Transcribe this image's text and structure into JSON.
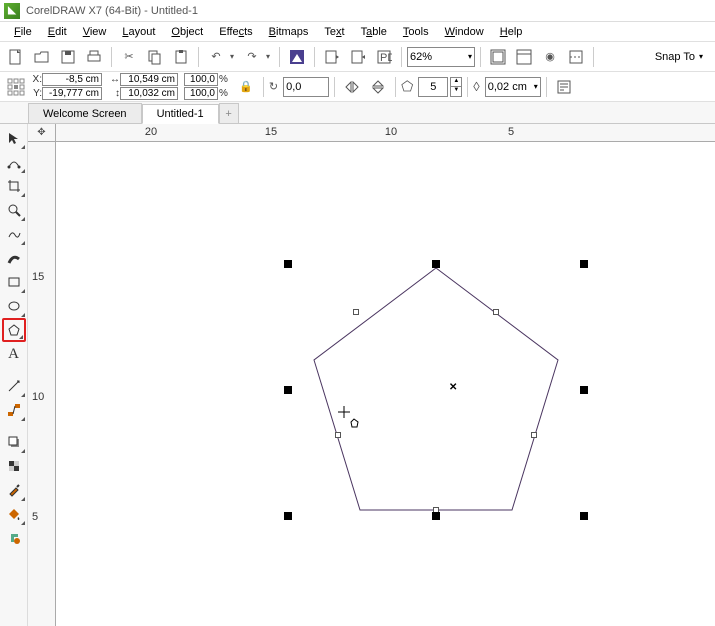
{
  "title": "CorelDRAW X7 (64-Bit) - Untitled-1",
  "menu": [
    "File",
    "Edit",
    "View",
    "Layout",
    "Object",
    "Effects",
    "Bitmaps",
    "Text",
    "Table",
    "Tools",
    "Window",
    "Help"
  ],
  "zoom": "62%",
  "snap": "Snap To",
  "props": {
    "x": "-8,5 cm",
    "y": "-19,777 cm",
    "w": "10,549 cm",
    "h": "10,032 cm",
    "sx": "100,0",
    "sy": "100,0",
    "rot": "0,0",
    "sides": "5",
    "outline": "0,02 cm"
  },
  "tabs": {
    "welcome": "Welcome Screen",
    "doc": "Untitled-1",
    "add": "+"
  },
  "ruler_h": {
    "a": "20",
    "b": "15",
    "c": "10",
    "d": "5"
  },
  "ruler_v": {
    "a": "15",
    "b": "10",
    "c": "5"
  },
  "chart_data": {
    "type": "polygon",
    "sides": 5,
    "position_cm": [
      -8.5,
      -19.777
    ],
    "size_cm": [
      10.549,
      10.032
    ],
    "scale_pct": [
      100.0,
      100.0
    ],
    "rotation_deg": 0.0,
    "outline_cm": 0.02
  }
}
